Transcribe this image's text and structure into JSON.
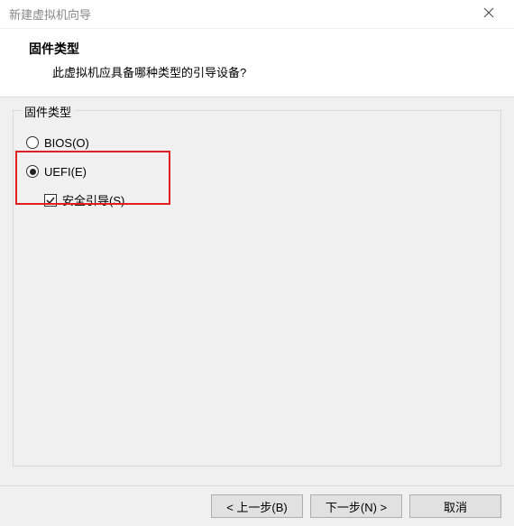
{
  "window": {
    "title": "新建虚拟机向导"
  },
  "header": {
    "heading": "固件类型",
    "subheading": "此虚拟机应具备哪种类型的引导设备?"
  },
  "group": {
    "legend": "固件类型",
    "options": {
      "bios_label": "BIOS(O)",
      "bios_selected": false,
      "uefi_label": "UEFI(E)",
      "uefi_selected": true,
      "secureboot_label": "安全引导(S)",
      "secureboot_checked": true
    }
  },
  "buttons": {
    "back": "< 上一步(B)",
    "next": "下一步(N) >",
    "cancel": "取消"
  }
}
